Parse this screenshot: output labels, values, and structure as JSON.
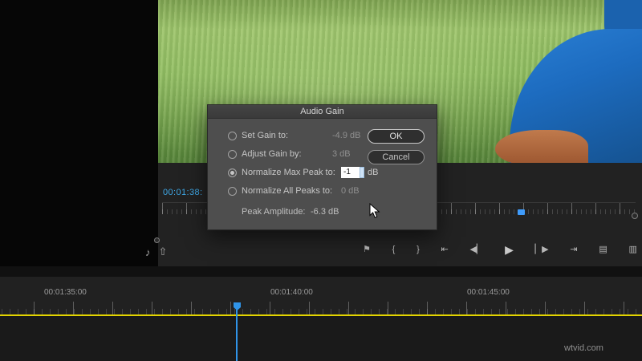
{
  "dialog": {
    "title": "Audio Gain",
    "options": [
      {
        "label": "Set Gain to:",
        "value": "-4.9 dB",
        "selected": false
      },
      {
        "label": "Adjust Gain by:",
        "value": "3 dB",
        "selected": false
      },
      {
        "label": "Normalize Max Peak to:",
        "value": "-1",
        "unit": "dB",
        "selected": true
      },
      {
        "label": "Normalize All Peaks to:",
        "value": "0 dB",
        "selected": false
      }
    ],
    "peak": {
      "label": "Peak Amplitude:",
      "value": "-6.3 dB"
    },
    "buttons": {
      "ok": "OK",
      "cancel": "Cancel"
    }
  },
  "monitor": {
    "timecode": "00:01:38:",
    "left_icons": [
      {
        "name": "audio-icon",
        "glyph": "♪"
      },
      {
        "name": "export-icon",
        "glyph": "⇧"
      }
    ],
    "transport": [
      {
        "name": "add-marker-icon",
        "glyph": "⚑"
      },
      {
        "name": "mark-in-icon",
        "glyph": "{"
      },
      {
        "name": "mark-out-icon",
        "glyph": "}"
      },
      {
        "name": "go-to-in-icon",
        "glyph": "⇤"
      },
      {
        "name": "step-back-icon",
        "glyph": "◀▏"
      },
      {
        "name": "play-icon",
        "glyph": "▶"
      },
      {
        "name": "step-forward-icon",
        "glyph": "▏▶"
      },
      {
        "name": "go-to-out-icon",
        "glyph": "⇥"
      },
      {
        "name": "lift-icon",
        "glyph": "▤"
      },
      {
        "name": "extract-icon",
        "glyph": "▥"
      }
    ]
  },
  "timeline": {
    "timestamps": [
      "00:01:35:00",
      "00:01:40:00",
      "00:01:45:00"
    ]
  },
  "watermark": "wtvid.com",
  "colors": {
    "accent_blue": "#3094e8",
    "timecode_blue": "#3fa9e8",
    "timeline_yellow": "#e3d400"
  }
}
